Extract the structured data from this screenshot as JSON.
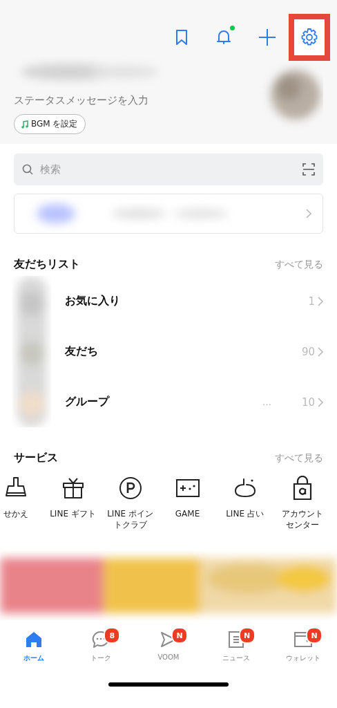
{
  "header_icons": [
    {
      "kind": "bookmark",
      "dot": false,
      "highlighted": false
    },
    {
      "kind": "bell",
      "dot": true,
      "highlighted": false
    },
    {
      "kind": "plus",
      "dot": false,
      "highlighted": false
    },
    {
      "kind": "settings",
      "dot": false,
      "highlighted": true
    }
  ],
  "profile": {
    "status_message": "ステータスメッセージを入力",
    "bgm_button": "BGM を設定"
  },
  "search": {
    "placeholder": "検索"
  },
  "friends": {
    "title": "友だちリスト",
    "see_all": "すべて見る",
    "rows": [
      {
        "label": "お気に入り",
        "count": "1"
      },
      {
        "label": "友だち",
        "count": "90"
      },
      {
        "label": "グループ",
        "count": "10",
        "preview": "…"
      }
    ]
  },
  "services": {
    "title": "サービス",
    "see_all": "すべて見る",
    "items": [
      {
        "kind": "brush",
        "label": "せかえ"
      },
      {
        "kind": "gift",
        "label": "LINE ギフト"
      },
      {
        "kind": "points",
        "label": "LINE ポイントクラブ"
      },
      {
        "kind": "game",
        "label": "GAME"
      },
      {
        "kind": "fortune",
        "label": "LINE 占い"
      },
      {
        "kind": "lock",
        "label": "アカウントセンター"
      }
    ]
  },
  "tabs": [
    {
      "kind": "home",
      "label": "ホーム",
      "selected": true
    },
    {
      "kind": "chat",
      "label": "トーク",
      "badge": "8",
      "selected": false
    },
    {
      "kind": "voom",
      "label": "VOOM",
      "badge": "N",
      "selected": false
    },
    {
      "kind": "news",
      "label": "ニュース",
      "badge": "N",
      "selected": false
    },
    {
      "kind": "wallet",
      "label": "ウォレット",
      "badge": "N",
      "selected": false
    }
  ]
}
